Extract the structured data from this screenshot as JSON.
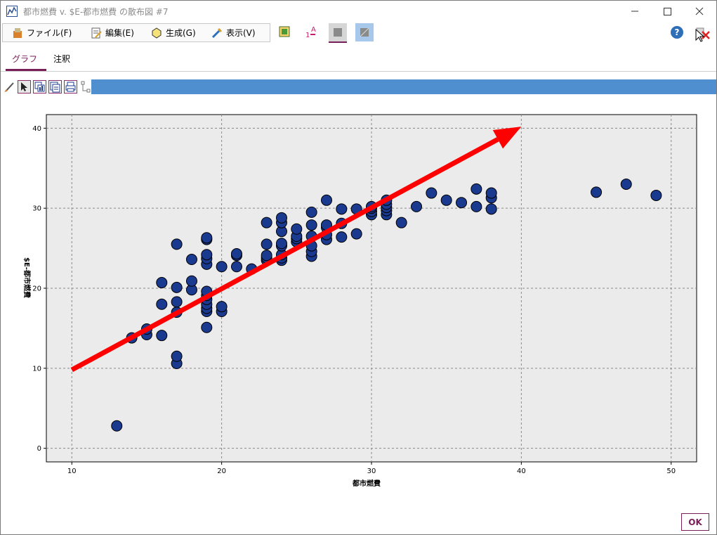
{
  "window": {
    "title": "都市燃費 v. $E-都市燃費 の散布図 #7",
    "icons": {
      "app": "scatterplot-app-icon",
      "minimize": "minimize-icon",
      "maximize": "maximize-icon",
      "close": "close-icon"
    }
  },
  "menu": {
    "items": [
      {
        "label": "ファイル(F)",
        "icon": "file-menu-icon"
      },
      {
        "label": "編集(E)",
        "icon": "edit-menu-icon"
      },
      {
        "label": "生成(G)",
        "icon": "generate-menu-icon"
      },
      {
        "label": "表示(V)",
        "icon": "view-menu-icon"
      }
    ]
  },
  "toolbar": {
    "buttons": [
      {
        "icon": "select-values-icon"
      },
      {
        "icon": "sort-icon"
      },
      {
        "icon": "gray-square-icon"
      },
      {
        "icon": "diagonal-square-icon"
      }
    ],
    "help_label": "?",
    "delete_icon": "delete-node-icon"
  },
  "tabs": [
    {
      "label": "グラフ",
      "active": true
    },
    {
      "label": "注釈",
      "active": false
    }
  ],
  "graph_toolbar": {
    "icons": [
      "brush-icon",
      "pointer-icon",
      "region-icon",
      "copy-chart-icon",
      "print-icon",
      "layout-icon"
    ],
    "bar_color": "#4f8fcf"
  },
  "chart_data": {
    "type": "scatter",
    "title": "",
    "xlabel": "都市燃費",
    "ylabel": "$E-都市燃費",
    "xlim": [
      8.3,
      51.7
    ],
    "ylim": [
      -1.7,
      41.7
    ],
    "xticks": [
      10,
      20,
      30,
      40,
      50
    ],
    "yticks": [
      0,
      10,
      20,
      30,
      40
    ],
    "grid": true,
    "marker_color": "#1a3a8f",
    "plot_background": "#ebebeb",
    "points": [
      [
        13,
        2.8
      ],
      [
        14,
        13.8
      ],
      [
        15,
        14.2
      ],
      [
        15,
        14.9
      ],
      [
        16,
        14.1
      ],
      [
        16,
        18.0
      ],
      [
        16,
        20.7
      ],
      [
        17,
        10.6
      ],
      [
        17,
        11.5
      ],
      [
        17,
        17.0
      ],
      [
        17,
        18.3
      ],
      [
        17,
        20.1
      ],
      [
        17,
        25.5
      ],
      [
        18,
        19.8
      ],
      [
        18,
        20.9
      ],
      [
        18,
        23.6
      ],
      [
        19,
        15.1
      ],
      [
        19,
        17.1
      ],
      [
        19,
        17.5
      ],
      [
        19,
        18.0
      ],
      [
        19,
        18.6
      ],
      [
        19,
        19.1
      ],
      [
        19,
        19.6
      ],
      [
        19,
        23.0
      ],
      [
        19,
        23.7
      ],
      [
        19,
        24.2
      ],
      [
        19,
        26.1
      ],
      [
        19,
        26.3
      ],
      [
        20,
        17.1
      ],
      [
        20,
        17.7
      ],
      [
        20,
        22.7
      ],
      [
        21,
        22.7
      ],
      [
        21,
        24.1
      ],
      [
        21,
        24.3
      ],
      [
        22,
        22.4
      ],
      [
        23,
        23.5
      ],
      [
        23,
        23.8
      ],
      [
        23,
        24.1
      ],
      [
        23,
        25.5
      ],
      [
        23,
        28.2
      ],
      [
        24,
        23.5
      ],
      [
        24,
        23.8
      ],
      [
        24,
        24.2
      ],
      [
        24,
        25.3
      ],
      [
        24,
        25.6
      ],
      [
        24,
        27.1
      ],
      [
        24,
        28.2
      ],
      [
        24,
        28.8
      ],
      [
        25,
        25.8
      ],
      [
        25,
        26.2
      ],
      [
        25,
        26.5
      ],
      [
        25,
        27.4
      ],
      [
        26,
        24.0
      ],
      [
        26,
        24.6
      ],
      [
        26,
        25.3
      ],
      [
        26,
        26.5
      ],
      [
        26,
        27.9
      ],
      [
        26,
        29.5
      ],
      [
        27,
        26.1
      ],
      [
        27,
        26.7
      ],
      [
        27,
        27.6
      ],
      [
        27,
        27.9
      ],
      [
        27,
        31.0
      ],
      [
        28,
        26.4
      ],
      [
        28,
        28.1
      ],
      [
        28,
        29.9
      ],
      [
        29,
        26.8
      ],
      [
        29,
        29.9
      ],
      [
        30,
        29.2
      ],
      [
        30,
        29.6
      ],
      [
        30,
        30.0
      ],
      [
        30,
        30.2
      ],
      [
        31,
        29.2
      ],
      [
        31,
        29.7
      ],
      [
        31,
        30.1
      ],
      [
        31,
        30.5
      ],
      [
        31,
        31.0
      ],
      [
        32,
        28.2
      ],
      [
        33,
        30.2
      ],
      [
        34,
        31.9
      ],
      [
        35,
        31.0
      ],
      [
        36,
        30.7
      ],
      [
        37,
        30.2
      ],
      [
        37,
        32.4
      ],
      [
        38,
        29.9
      ],
      [
        38,
        31.3
      ],
      [
        38,
        31.9
      ],
      [
        45,
        32.0
      ],
      [
        47,
        33.0
      ],
      [
        49,
        31.6
      ]
    ],
    "annotations": [
      {
        "type": "arrow",
        "from": [
          10,
          9.8
        ],
        "to": [
          40,
          40.2
        ],
        "color": "#ff0000"
      }
    ]
  },
  "footer": {
    "ok_label": "OK"
  }
}
